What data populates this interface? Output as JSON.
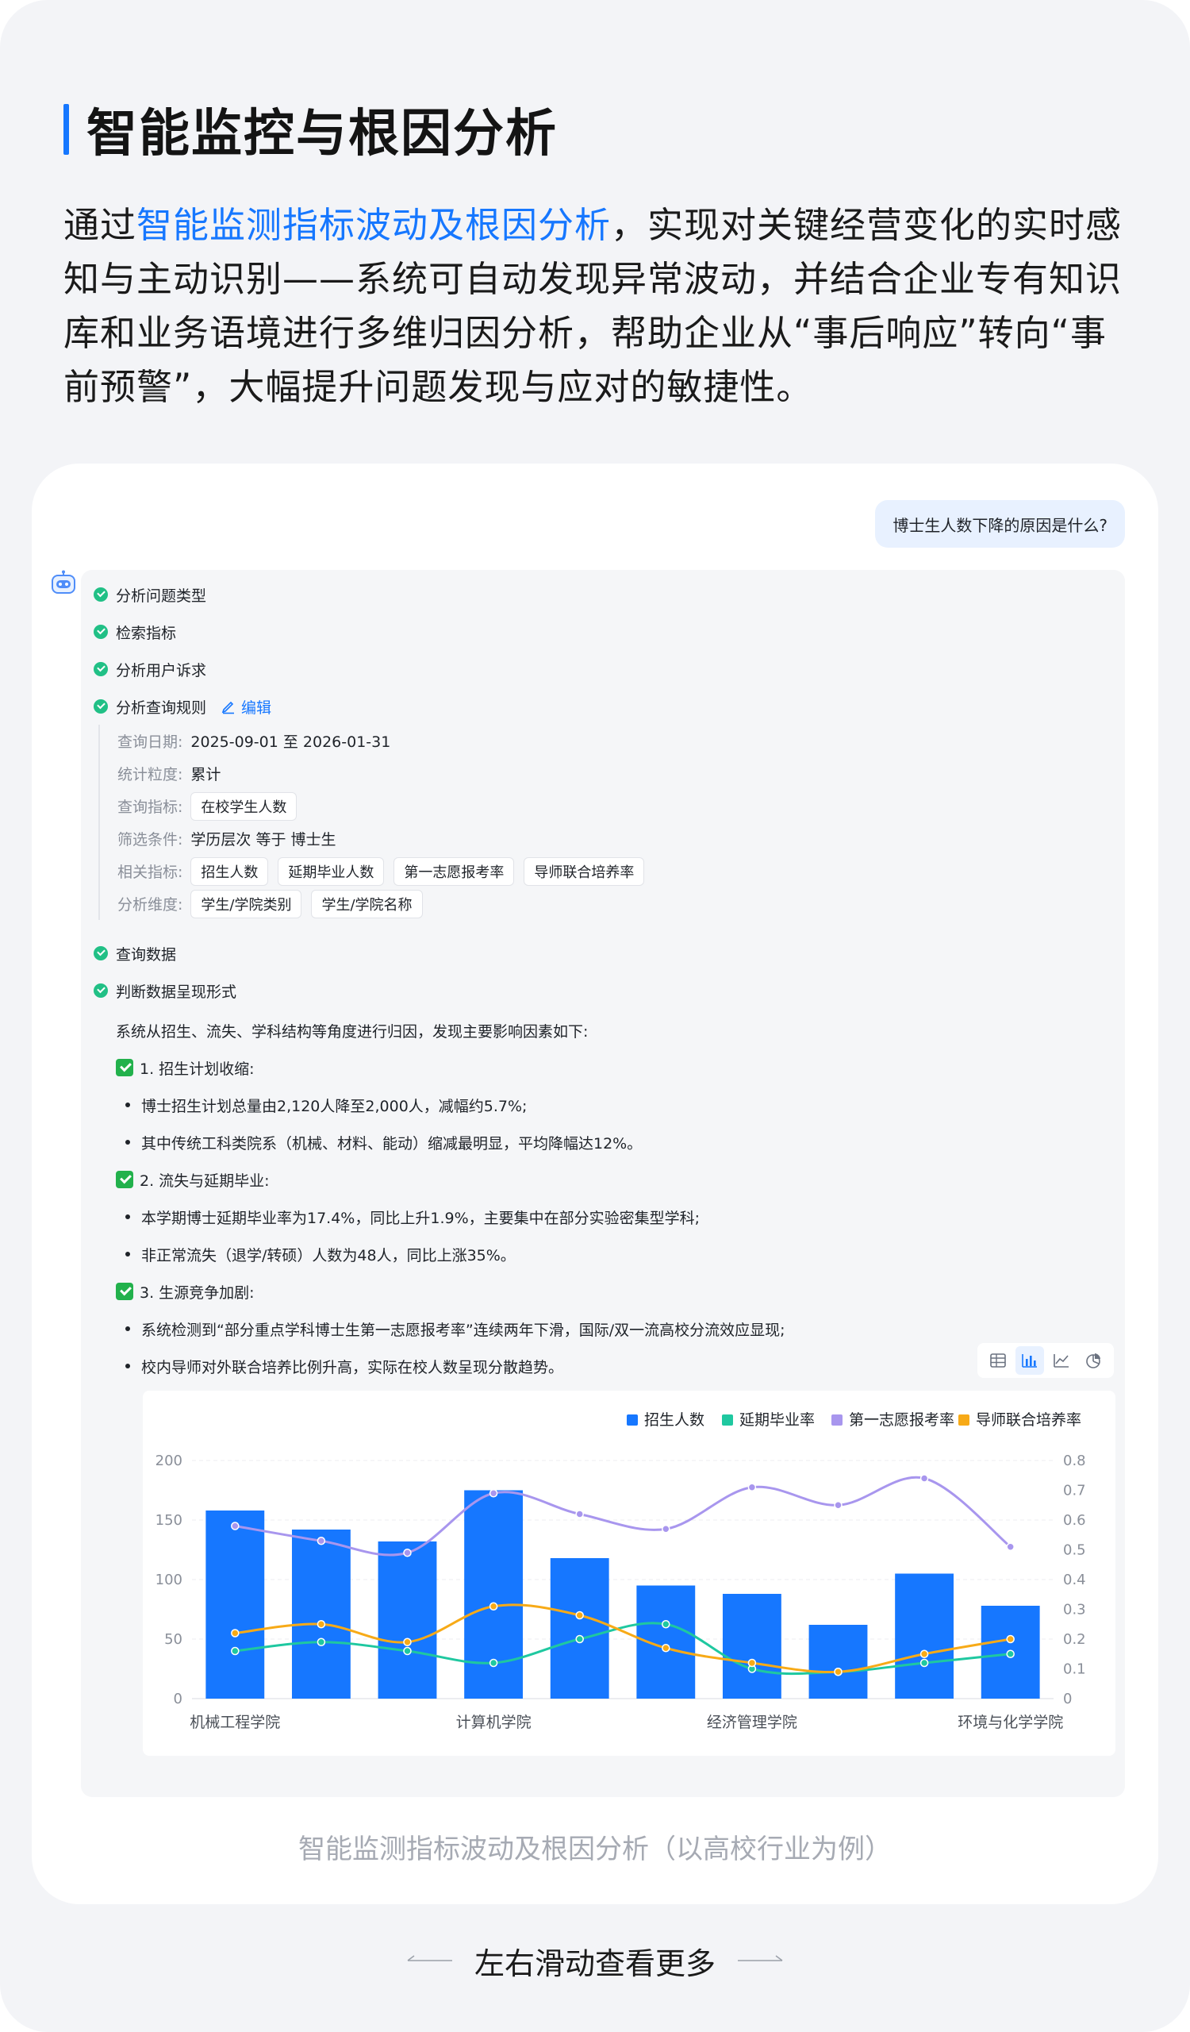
{
  "heading": "智能监控与根因分析",
  "intro": {
    "pre": "通过",
    "highlight": "智能监测指标波动及根因分析",
    "post": "，实现对关键经营变化的实时感知与主动识别——系统可自动发现异常波动，并结合企业专有知识库和业务语境进行多维归因分析，帮助企业从“事后响应”转向“事前预警”，大幅提升问题发现与应对的敏捷性。"
  },
  "chat": {
    "user_question": "博士生人数下降的原因是什么?",
    "steps": [
      "分析问题类型",
      "检索指标",
      "分析用户诉求",
      "分析查询规则",
      "查询数据",
      "判断数据呈现形式"
    ],
    "edit_label": "编辑",
    "rules": {
      "date_label": "查询日期:",
      "date_value": "2025-09-01 至 2026-01-31",
      "granularity_label": "统计粒度:",
      "granularity_value": "累计",
      "metric_label": "查询指标:",
      "metric_value": "在校学生人数",
      "filter_label": "筛选条件:",
      "filter_value": "学历层次 等于 博士生",
      "related_label": "相关指标:",
      "related": [
        "招生人数",
        "延期毕业人数",
        "第一志愿报考率",
        "导师联合培养率"
      ],
      "dims_label": "分析维度:",
      "dims": [
        "学生/学院类别",
        "学生/学院名称"
      ]
    },
    "summary": "系统从招生、流失、学科结构等角度进行归因，发现主要影响因素如下:",
    "sections": [
      {
        "title": "1. 招生计划收缩:",
        "bullets": [
          "博士招生计划总量由2,120人降至2,000人，减幅约5.7%;",
          "其中传统工科类院系（机械、材料、能动）缩减最明显，平均降幅达12%。"
        ]
      },
      {
        "title": "2. 流失与延期毕业:",
        "bullets": [
          "本学期博士延期毕业率为17.4%，同比上升1.9%，主要集中在部分实验密集型学科;",
          "非正常流失（退学/转硕）人数为48人，同比上涨35%。"
        ]
      },
      {
        "title": "3. 生源竞争加剧:",
        "bullets": [
          "系统检测到“部分重点学科博士生第一志愿报考率”连续两年下滑，国际/双一流高校分流效应显现;",
          "校内导师对外联合培养比例升高，实际在校人数呈现分散趋势。"
        ]
      }
    ]
  },
  "caption": "智能监测指标波动及根因分析（以高校行业为例）",
  "footer": "左右滑动查看更多",
  "colors": {
    "bar": "#1677ff",
    "delay": "#1fc8a0",
    "first_choice": "#a896ee",
    "joint": "#f7aa17"
  },
  "chart_data": {
    "type": "bar",
    "categories": [
      "机械工程学院",
      "",
      "",
      "计算机学院",
      "",
      "",
      "经济管理学院",
      "",
      "",
      "环境与化学学院"
    ],
    "x_tick_labels": [
      "机械工程学院",
      "计算机学院",
      "经济管理学院",
      "环境与化学学院"
    ],
    "series": [
      {
        "name": "招生人数",
        "type": "bar",
        "axis": "left",
        "values": [
          158,
          142,
          132,
          175,
          118,
          95,
          88,
          62,
          105,
          78
        ]
      },
      {
        "name": "延期毕业率",
        "type": "line",
        "axis": "right",
        "values": [
          0.16,
          0.19,
          0.16,
          0.12,
          0.2,
          0.25,
          0.1,
          0.09,
          0.12,
          0.15
        ]
      },
      {
        "name": "第一志愿报考率",
        "type": "line",
        "axis": "right",
        "values": [
          0.58,
          0.53,
          0.49,
          0.69,
          0.62,
          0.57,
          0.71,
          0.65,
          0.74,
          0.51
        ]
      },
      {
        "name": "导师联合培养率",
        "type": "line",
        "axis": "right",
        "values": [
          0.22,
          0.25,
          0.19,
          0.31,
          0.28,
          0.17,
          0.12,
          0.09,
          0.15,
          0.2
        ]
      }
    ],
    "ylim_left": [
      0,
      200
    ],
    "yticks_left": [
      0,
      50,
      100,
      150,
      200
    ],
    "ylim_right": [
      0,
      0.8
    ],
    "yticks_right": [
      0,
      0.1,
      0.2,
      0.3,
      0.4,
      0.5,
      0.6,
      0.7,
      0.8
    ],
    "legend_position": "top-right",
    "grid": true
  }
}
